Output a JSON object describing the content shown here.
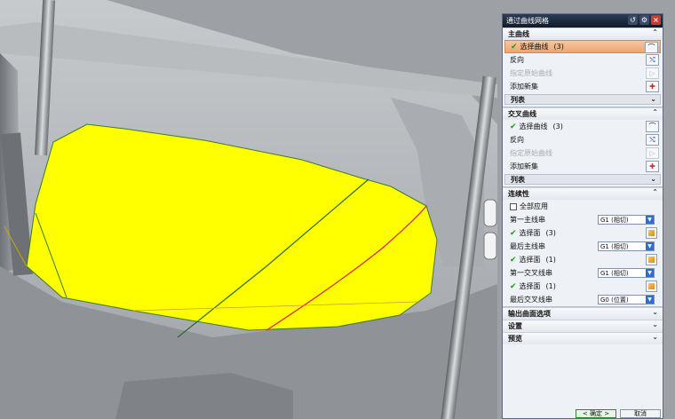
{
  "dialog": {
    "title": "通过曲线网格",
    "primary": {
      "header": "主曲线",
      "select_label": "选择曲线",
      "select_count": "(3)",
      "reverse": "反向",
      "specify_origin": "指定原始曲线",
      "add_set": "添加新集",
      "list": "列表"
    },
    "cross": {
      "header": "交叉曲线",
      "select_label": "选择曲线",
      "select_count": "(3)",
      "reverse": "反向",
      "specify_origin": "指定原始曲线",
      "add_set": "添加新集",
      "list": "列表"
    },
    "continuity": {
      "header": "连续性",
      "apply_all": "全部应用",
      "first_primary": "第一主线串",
      "first_primary_value": "G1 (相切)",
      "first_primary_face": "选择面",
      "first_primary_face_count": "(3)",
      "last_primary": "最后主线串",
      "last_primary_value": "G1 (相切)",
      "last_primary_face": "选择面",
      "last_primary_face_count": "(1)",
      "first_cross": "第一交叉线串",
      "first_cross_value": "G1 (相切)",
      "first_cross_face": "选择面",
      "first_cross_face_count": "(1)",
      "last_cross": "最后交叉线串",
      "last_cross_value": "G0 (位置)"
    },
    "output_options": "输出曲面选项",
    "settings": "设置",
    "preview": "预览",
    "ok": "< 确定 >",
    "cancel": "取消"
  },
  "colors": {
    "surface_fill": "#ffff00",
    "titlebar": "#1a2538",
    "selected_row": "#eea56f",
    "check": "#1a9b1a"
  }
}
